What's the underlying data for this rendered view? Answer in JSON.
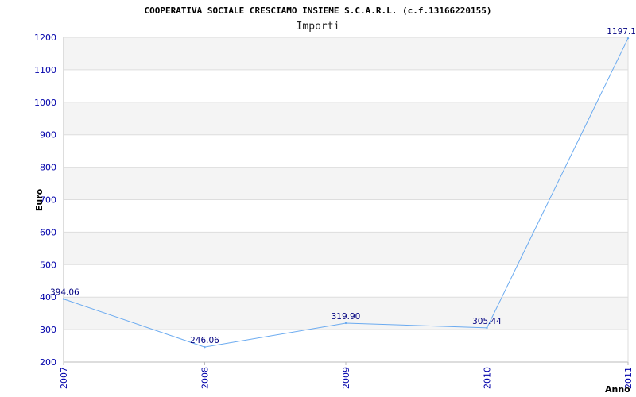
{
  "chart_data": {
    "type": "line",
    "title": "COOPERATIVA SOCIALE CRESCIAMO INSIEME S.C.A.R.L. (c.f.13166220155)",
    "subtitle": "Importi",
    "xlabel": "Anno",
    "ylabel": "Euro",
    "categories": [
      "2007",
      "2008",
      "2009",
      "2010",
      "2011"
    ],
    "series": [
      {
        "values": [
          394.06,
          246.06,
          319.9,
          305.44,
          1197.1
        ],
        "labels": [
          "394.06",
          "246.06",
          "319.90",
          "305.44",
          "1197.1"
        ],
        "color": "#6aaaf0"
      }
    ],
    "ylim": [
      200,
      1200
    ],
    "yticks": [
      "200",
      "300",
      "400",
      "500",
      "600",
      "700",
      "800",
      "900",
      "1000",
      "1100",
      "1200"
    ],
    "grid": true,
    "band_colors": [
      "#f4f4f4",
      "#ffffff"
    ]
  }
}
